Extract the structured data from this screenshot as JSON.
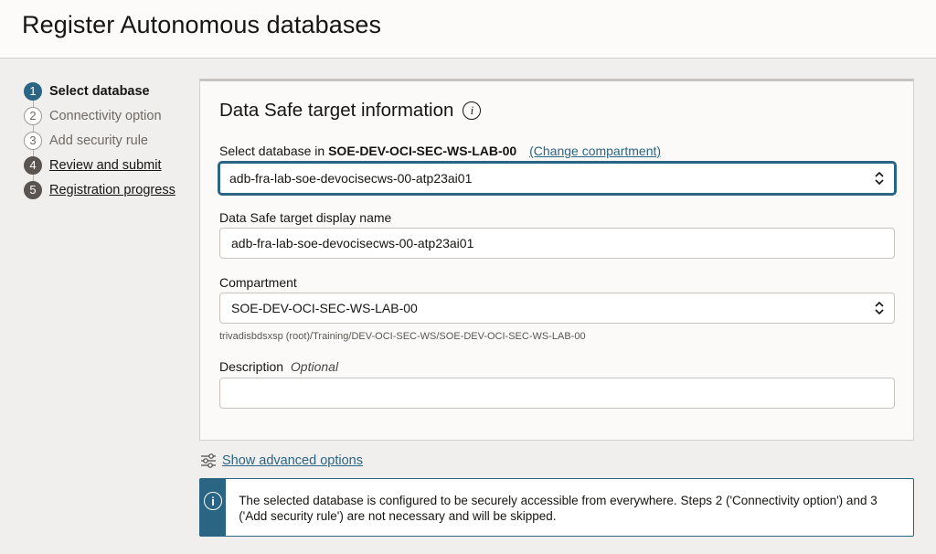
{
  "header": {
    "title": "Register Autonomous databases"
  },
  "stepper": {
    "steps": [
      {
        "num": "1",
        "label": "Select database",
        "state": "active"
      },
      {
        "num": "2",
        "label": "Connectivity option",
        "state": "future"
      },
      {
        "num": "3",
        "label": "Add security rule",
        "state": "future"
      },
      {
        "num": "4",
        "label": "Review and submit",
        "state": "link"
      },
      {
        "num": "5",
        "label": "Registration progress",
        "state": "link"
      }
    ]
  },
  "card": {
    "title": "Data Safe target information",
    "select_db": {
      "label_prefix": "Select database in",
      "compartment": "SOE-DEV-OCI-SEC-WS-LAB-00",
      "change_link": "(Change compartment)",
      "value": "adb-fra-lab-soe-devocisecws-00-atp23ai01"
    },
    "display_name": {
      "label": "Data Safe target display name",
      "value": "adb-fra-lab-soe-devocisecws-00-atp23ai01"
    },
    "compartment": {
      "label": "Compartment",
      "value": "SOE-DEV-OCI-SEC-WS-LAB-00",
      "hint": "trivadisbdsxsp (root)/Training/DEV-OCI-SEC-WS/SOE-DEV-OCI-SEC-WS-LAB-00"
    },
    "description": {
      "label": "Description",
      "optional": "Optional",
      "value": ""
    }
  },
  "advanced": {
    "label": "Show advanced options"
  },
  "banner": {
    "text": "The selected database is configured to be securely accessible from everywhere. Steps 2 ('Connectivity option') and 3 ('Add security rule') are not necessary and will be skipped."
  },
  "colors": {
    "accent": "#2b6584",
    "background": "#f1efed"
  }
}
